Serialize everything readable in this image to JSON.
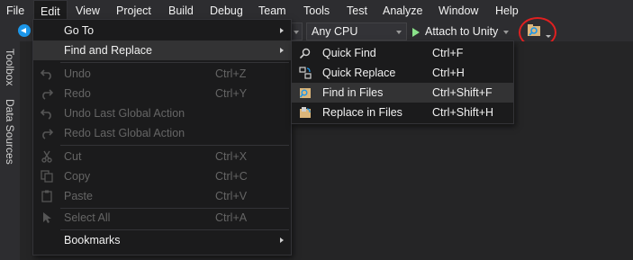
{
  "menubar": {
    "items": [
      {
        "label": "File"
      },
      {
        "label": "Edit"
      },
      {
        "label": "View"
      },
      {
        "label": "Project"
      },
      {
        "label": "Build"
      },
      {
        "label": "Debug"
      },
      {
        "label": "Team"
      },
      {
        "label": "Tools"
      },
      {
        "label": "Test"
      },
      {
        "label": "Analyze"
      },
      {
        "label": "Window"
      },
      {
        "label": "Help"
      }
    ]
  },
  "toolbar": {
    "platform": "Any CPU",
    "attach": "Attach to Unity"
  },
  "side_tabs": {
    "toolbox": "Toolbox",
    "data_sources": "Data Sources"
  },
  "edit_menu": {
    "goto": "Go To",
    "find_replace": "Find and Replace",
    "undo": "Undo",
    "undo_sc": "Ctrl+Z",
    "redo": "Redo",
    "redo_sc": "Ctrl+Y",
    "undo_global": "Undo Last Global Action",
    "redo_global": "Redo Last Global Action",
    "cut": "Cut",
    "cut_sc": "Ctrl+X",
    "copy": "Copy",
    "copy_sc": "Ctrl+C",
    "paste": "Paste",
    "paste_sc": "Ctrl+V",
    "select_all": "Select All",
    "select_all_sc": "Ctrl+A",
    "bookmarks": "Bookmarks"
  },
  "find_submenu": {
    "quick_find": "Quick Find",
    "quick_find_sc": "Ctrl+F",
    "quick_replace": "Quick Replace",
    "quick_replace_sc": "Ctrl+H",
    "find_in_files": "Find in Files",
    "find_in_files_sc": "Ctrl+Shift+F",
    "replace_in_files": "Replace in Files",
    "replace_in_files_sc": "Ctrl+Shift+H"
  },
  "colors": {
    "background": "#2d2d30",
    "menu_bg": "#1b1b1c",
    "highlight": "#333334",
    "accent": "#1c97ea",
    "annotation": "#e02020"
  }
}
